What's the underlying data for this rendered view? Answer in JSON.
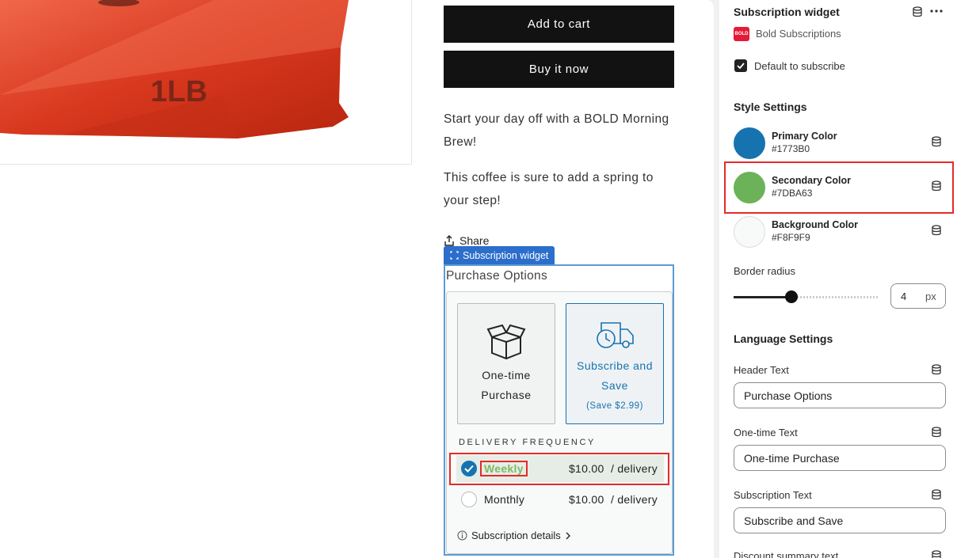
{
  "product": {
    "bag_label": "1LB",
    "add_to_cart": "Add to cart",
    "buy_now": "Buy it now",
    "description_lines": [
      "Start your day off with a BOLD Morning",
      "Brew!"
    ],
    "description2_lines": [
      "This coffee is sure to add a spring to",
      "your step!"
    ],
    "share_label": "Share"
  },
  "widget": {
    "tag_label": "Subscription widget",
    "header": "Purchase Options",
    "one_time_lines": [
      "One-time",
      "Purchase"
    ],
    "subscribe_lines": [
      "Subscribe and",
      "Save"
    ],
    "savings": "(Save $2.99)",
    "frequency_title": "DELIVERY FREQUENCY",
    "frequencies": [
      {
        "label": "Weekly",
        "price": "$10.00",
        "unit": "/ delivery",
        "selected": true
      },
      {
        "label": "Monthly",
        "price": "$10.00",
        "unit": "/ delivery",
        "selected": false
      }
    ],
    "details_label": "Subscription details"
  },
  "panel": {
    "title": "Subscription widget",
    "app_name": "Bold Subscriptions",
    "app_badge": "BOLD",
    "default_to_subscribe": {
      "label": "Default to subscribe",
      "checked": true
    },
    "style_title": "Style Settings",
    "colors": [
      {
        "name": "Primary Color",
        "hex": "#1773B0"
      },
      {
        "name": "Secondary Color",
        "hex": "#7DBA63"
      },
      {
        "name": "Background Color",
        "hex": "#F8F9F9"
      }
    ],
    "border_radius": {
      "label": "Border radius",
      "value": "4",
      "unit": "px",
      "fraction": 0.4
    },
    "language_title": "Language Settings",
    "fields": [
      {
        "label": "Header Text",
        "value": "Purchase Options"
      },
      {
        "label": "One-time Text",
        "value": "One-time Purchase"
      },
      {
        "label": "Subscription Text",
        "value": "Subscribe and Save"
      },
      {
        "label": "Discount summary text",
        "value": ""
      }
    ]
  },
  "colors": {
    "primary": "#1773b0",
    "secondary": "#7dba63",
    "highlight": "#e52a2a",
    "bag": "#e4452f"
  }
}
